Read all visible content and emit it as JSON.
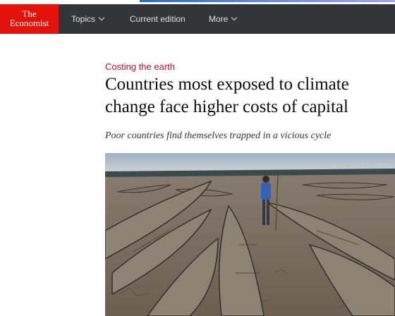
{
  "brand": {
    "line1": "The",
    "line2": "Economist",
    "color": "#e3120b"
  },
  "nav": {
    "topics_label": "Topics",
    "current_edition_label": "Current edition",
    "more_label": "More"
  },
  "article": {
    "kicker": "Costing the earth",
    "headline": "Countries most exposed to climate change face higher costs of capital",
    "subheadline": "Poor countries find themselves trapped in a vicious cycle"
  },
  "colors": {
    "navbar": "#333539",
    "kicker": "#c8102e"
  },
  "icons": {
    "dropdown": "chevron-down-icon"
  }
}
